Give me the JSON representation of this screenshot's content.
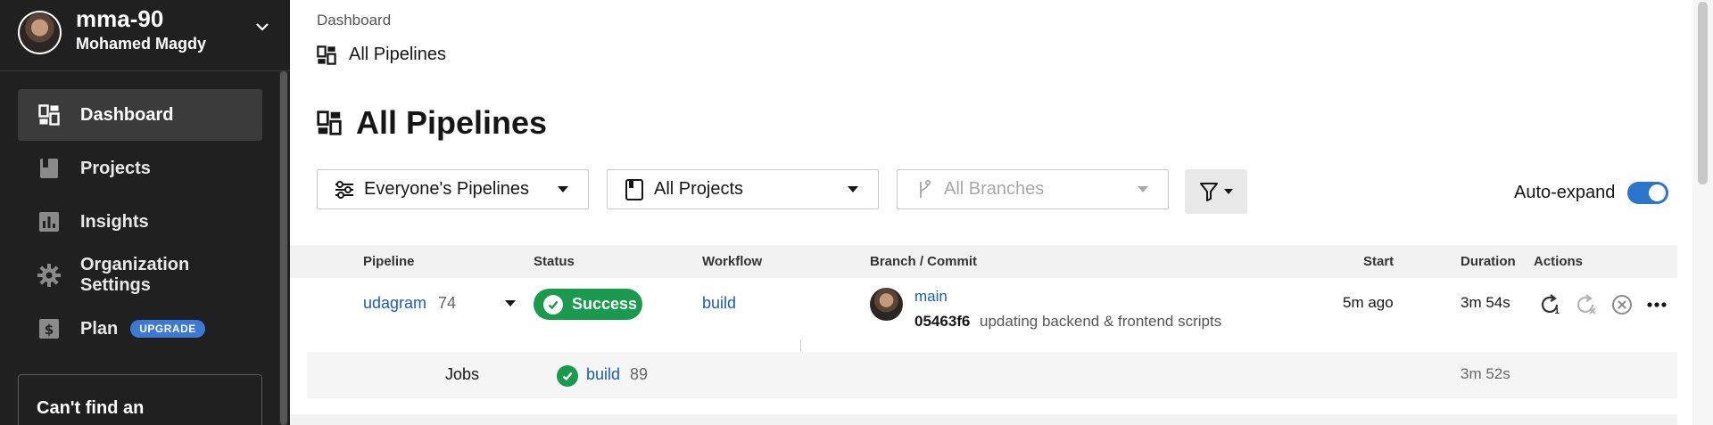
{
  "org": {
    "name": "mma-90",
    "user": "Mohamed Magdy"
  },
  "sidebar": {
    "items": [
      {
        "label": "Dashboard",
        "icon": "dashboard-icon",
        "active": true
      },
      {
        "label": "Projects",
        "icon": "book-icon"
      },
      {
        "label": "Insights",
        "icon": "bar-chart-icon"
      },
      {
        "label": "Organization Settings",
        "icon": "gear-icon"
      },
      {
        "label": "Plan",
        "icon": "dollar-icon",
        "badge": "UPGRADE"
      }
    ],
    "help_title": "Can't find an"
  },
  "header": {
    "breadcrumb": "Dashboard",
    "subtitle": "All Pipelines",
    "title": "All Pipelines"
  },
  "filters": {
    "pipelines": "Everyone's Pipelines",
    "projects": "All Projects",
    "branches": "All Branches",
    "auto_expand_label": "Auto-expand",
    "auto_expand_on": true
  },
  "table": {
    "columns": [
      "Pipeline",
      "Status",
      "Workflow",
      "Branch / Commit",
      "Start",
      "Duration",
      "Actions"
    ],
    "row": {
      "pipeline": "udagram",
      "number": "74",
      "status": "Success",
      "workflow": "build",
      "branch": "main",
      "commit_hash": "05463f6",
      "commit_msg": "updating backend & frontend scripts",
      "start": "5m ago",
      "duration": "3m 54s"
    },
    "jobs": {
      "label": "Jobs",
      "name": "build",
      "number": "89",
      "duration": "3m 52s"
    }
  },
  "colors": {
    "accent": "#2a74c9",
    "success": "#1a9a4c",
    "link": "#1b5fa8",
    "sidebar": "#202020"
  }
}
